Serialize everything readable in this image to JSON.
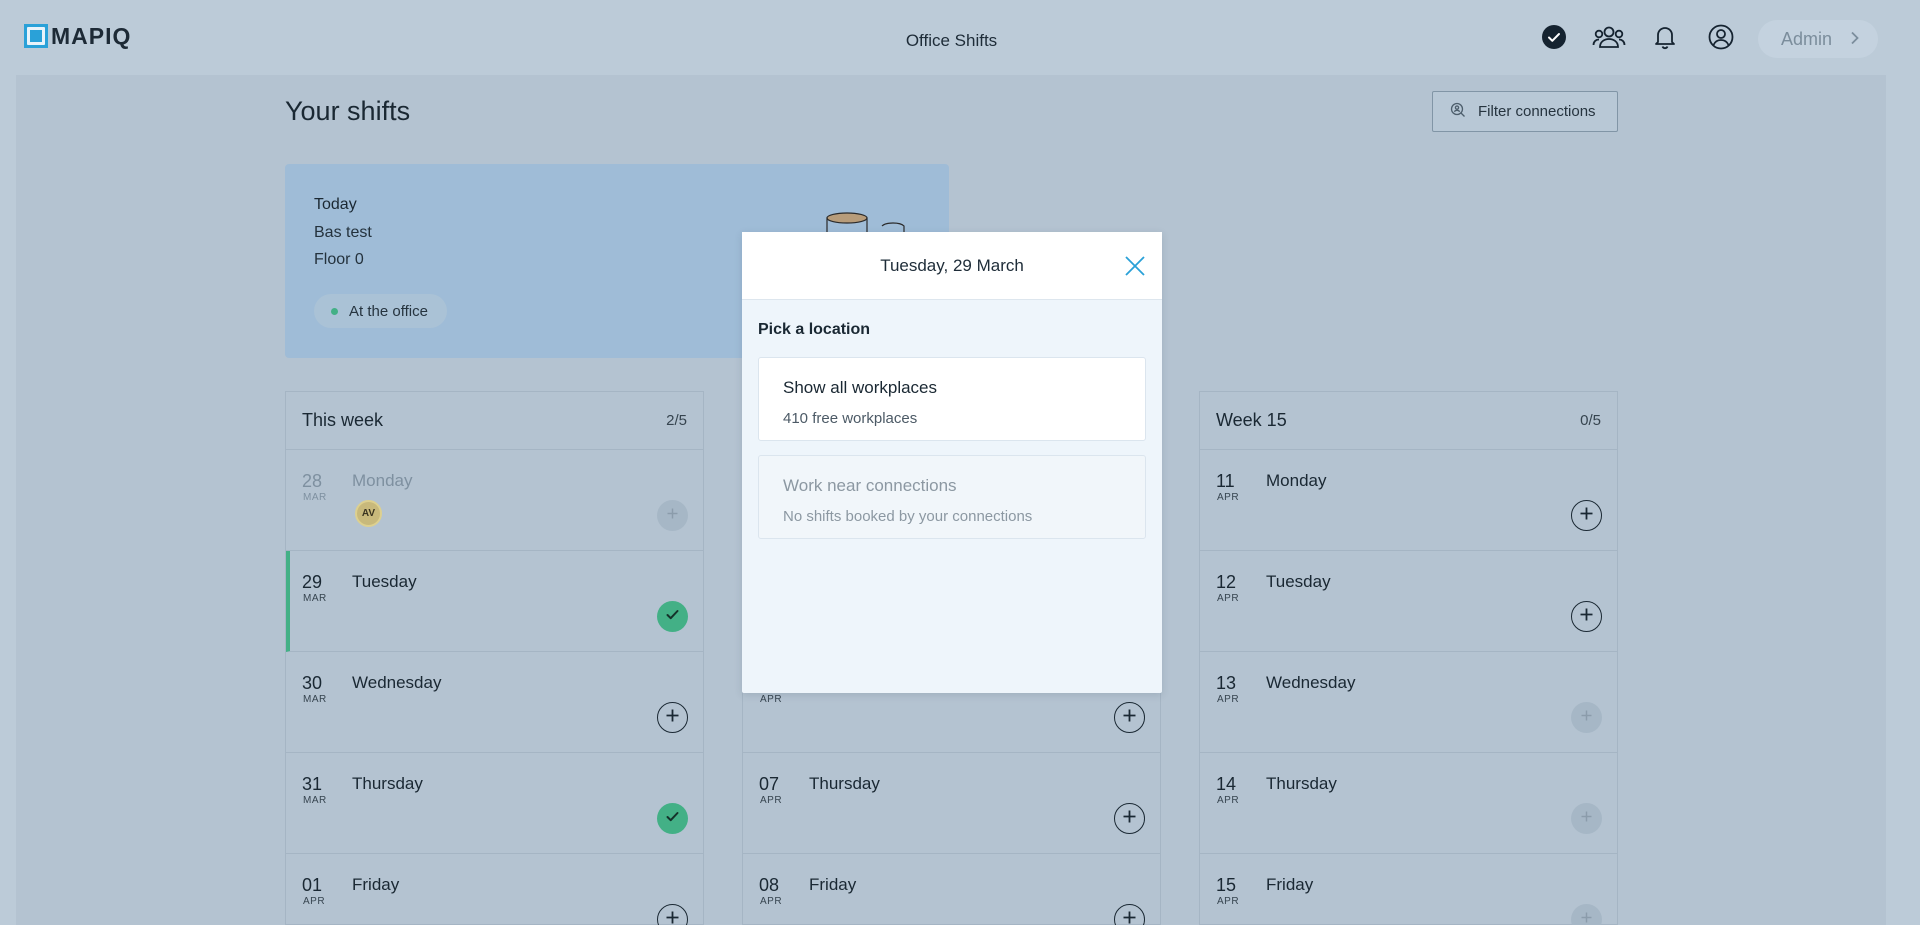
{
  "app": {
    "logo_text": "MAPIQ",
    "title": "Office Shifts",
    "user_label": "Admin"
  },
  "page": {
    "title": "Your shifts",
    "filter_label": "Filter connections"
  },
  "today": {
    "label": "Today",
    "location": "Bas test",
    "floor": "Floor 0",
    "status": "At the office"
  },
  "weeks": [
    {
      "title": "This week",
      "count": "2/5",
      "days": [
        {
          "num": "28",
          "month": "MAR",
          "name": "Monday",
          "state": "past",
          "action": "add-disabled",
          "avatar": "AV"
        },
        {
          "num": "29",
          "month": "MAR",
          "name": "Tuesday",
          "state": "selected",
          "action": "booked"
        },
        {
          "num": "30",
          "month": "MAR",
          "name": "Wednesday",
          "state": "normal",
          "action": "add"
        },
        {
          "num": "31",
          "month": "MAR",
          "name": "Thursday",
          "state": "normal",
          "action": "booked"
        },
        {
          "num": "01",
          "month": "APR",
          "name": "Friday",
          "state": "normal",
          "action": "add"
        }
      ]
    },
    {
      "title": "",
      "count": "",
      "days": [
        {
          "num": "",
          "month": "",
          "name": "",
          "state": "normal",
          "action": "none"
        },
        {
          "num": "",
          "month": "",
          "name": "",
          "state": "normal",
          "action": "none"
        },
        {
          "num": "",
          "month": "APR",
          "name": "",
          "state": "normal",
          "action": "add"
        },
        {
          "num": "07",
          "month": "APR",
          "name": "Thursday",
          "state": "normal",
          "action": "add"
        },
        {
          "num": "08",
          "month": "APR",
          "name": "Friday",
          "state": "normal",
          "action": "add"
        }
      ]
    },
    {
      "title": "Week 15",
      "count": "0/5",
      "days": [
        {
          "num": "11",
          "month": "APR",
          "name": "Monday",
          "state": "normal",
          "action": "add"
        },
        {
          "num": "12",
          "month": "APR",
          "name": "Tuesday",
          "state": "normal",
          "action": "add"
        },
        {
          "num": "13",
          "month": "APR",
          "name": "Wednesday",
          "state": "normal",
          "action": "add-disabled"
        },
        {
          "num": "14",
          "month": "APR",
          "name": "Thursday",
          "state": "normal",
          "action": "add-disabled"
        },
        {
          "num": "15",
          "month": "APR",
          "name": "Friday",
          "state": "normal",
          "action": "add-disabled"
        }
      ]
    }
  ],
  "modal": {
    "title": "Tuesday, 29 March",
    "subtitle": "Pick a location",
    "options": [
      {
        "title": "Show all workplaces",
        "detail": "410 free workplaces",
        "enabled": true
      },
      {
        "title": "Work near connections",
        "detail": "No shifts booked by your connections",
        "enabled": false
      }
    ]
  },
  "colors": {
    "accent": "#2aa1d8",
    "success": "#43b086",
    "background": "#bccbd8"
  },
  "icons": [
    "check-circle-icon",
    "people-icon",
    "bell-icon",
    "user-icon",
    "chevron-right-icon",
    "search-person-icon",
    "close-icon",
    "plus-circle-icon",
    "check-icon"
  ]
}
